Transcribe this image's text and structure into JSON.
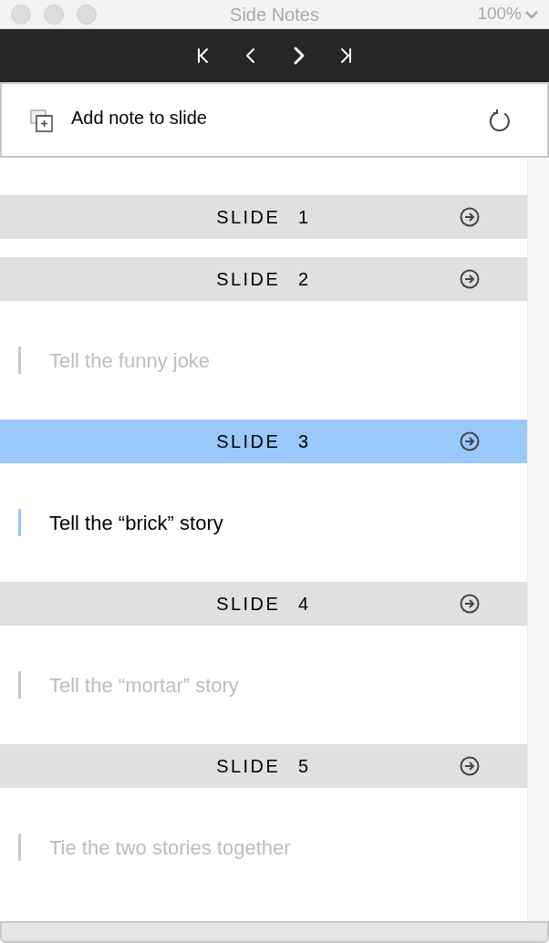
{
  "window": {
    "title": "Side Notes",
    "zoom": "100%"
  },
  "add_note": {
    "label": "Add note to slide"
  },
  "slides": [
    {
      "title": "SLIDE 1",
      "selected": false
    },
    {
      "title": "SLIDE 2",
      "selected": false,
      "note": "Tell the funny joke"
    },
    {
      "title": "SLIDE 3",
      "selected": true,
      "note": "Tell the “brick” story"
    },
    {
      "title": "SLIDE 4",
      "selected": false,
      "note": "Tell the “mortar” story"
    },
    {
      "title": "SLIDE 5",
      "selected": false,
      "note": "Tie the two stories together"
    }
  ]
}
